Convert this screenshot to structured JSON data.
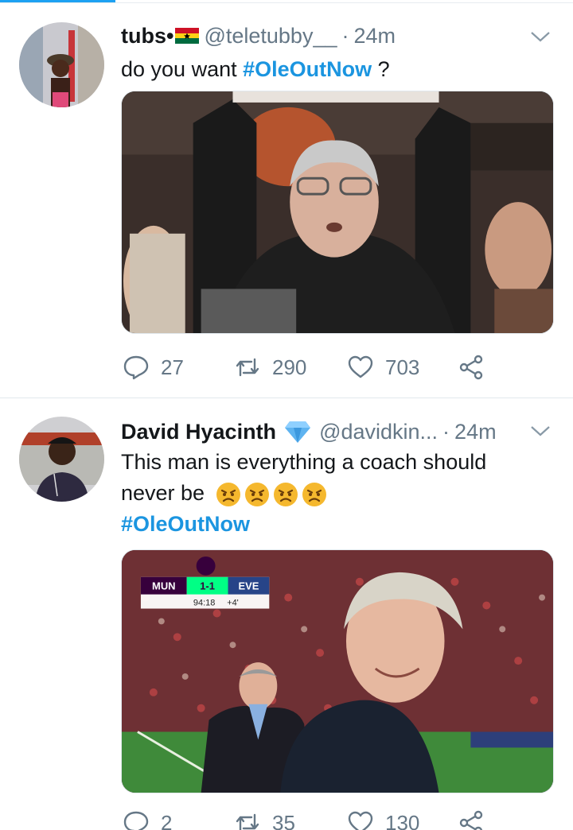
{
  "tweets": [
    {
      "display_name": "tubs•",
      "flag_icon": "ghana-flag-emoji",
      "handle": "@teletubby__",
      "separator": "·",
      "time": "24m",
      "text_before": "do you want ",
      "hashtag": "#OleOutNow",
      "text_after": " ?",
      "stats": {
        "replies": "27",
        "retweets": "290",
        "likes": "703"
      }
    },
    {
      "display_name": "David Hyacinth",
      "verified_icon": "blue-diamond-emoji",
      "handle": "@davidkin...",
      "separator": "·",
      "time": "24m",
      "text_line1": "This man is everything a coach should",
      "text_line2": "never be",
      "emojis": [
        "angry-face-emoji",
        "angry-face-emoji",
        "angry-face-emoji",
        "angry-face-emoji"
      ],
      "hashtag": "#OleOutNow",
      "scoreboard": {
        "home": "MUN",
        "score": "1-1",
        "away": "EVE",
        "clock": "94:18",
        "added": "+4'"
      },
      "stats": {
        "replies": "2",
        "retweets": "35",
        "likes": "130"
      }
    }
  ],
  "colors": {
    "accent": "#1da1f2",
    "hashtag": "#1b95e0",
    "secondary_text": "#657786",
    "divider": "#e1e8ed"
  }
}
